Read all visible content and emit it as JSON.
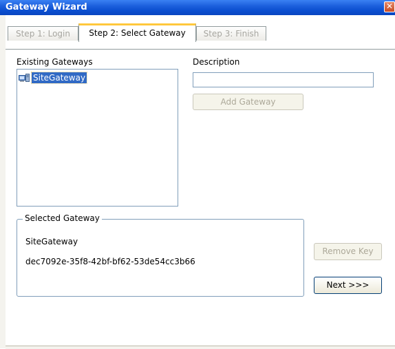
{
  "window": {
    "title": "Gateway Wizard",
    "close_glyph": "✕"
  },
  "tabs": [
    {
      "label": "Step 1: Login",
      "active": false
    },
    {
      "label": "Step 2: Select Gateway",
      "active": true
    },
    {
      "label": "Step 3: Finish",
      "active": false
    }
  ],
  "existing": {
    "label": "Existing Gateways",
    "items": [
      {
        "label": "SiteGateway",
        "icon": "gateway-icon",
        "selected": true
      }
    ]
  },
  "description": {
    "label": "Description",
    "value": ""
  },
  "buttons": {
    "add_gateway": "Add Gateway",
    "remove_key": "Remove Key",
    "next": "Next >>>"
  },
  "selected_gateway": {
    "legend": "Selected Gateway",
    "name": "SiteGateway",
    "id": "dec7092e-35f8-42bf-bf62-53de54cc3b66"
  },
  "colors": {
    "titlebar": "#0b4fd0",
    "selection": "#316ac5",
    "active_tab_accent": "#ffc73c",
    "border": "#7f9db9"
  }
}
